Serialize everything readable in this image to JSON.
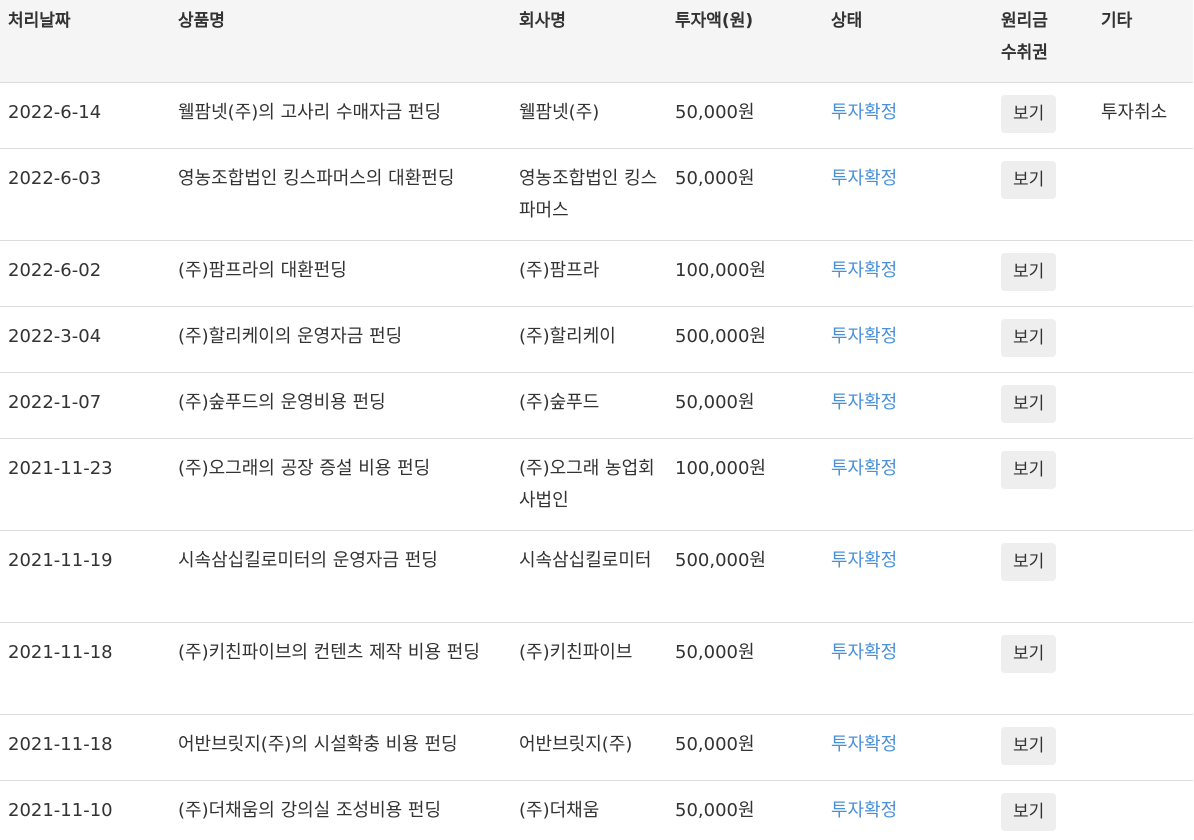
{
  "headers": {
    "date": "처리날짜",
    "product": "상품명",
    "company": "회사명",
    "amount": "투자액(원)",
    "status": "상태",
    "cert_line1": "원리금",
    "cert_line2": "수취권",
    "etc": "기타"
  },
  "rows": [
    {
      "date": "2022-6-14",
      "product": "웰팜넷(주)의 고사리 수매자금 펀딩",
      "company": "웰팜넷(주)",
      "amount": "50,000원",
      "status": "투자확정",
      "view": "보기",
      "etc": "투자취소"
    },
    {
      "date": "2022-6-03",
      "product": "영농조합법인 킹스파머스의 대환펀딩",
      "company": "영농조합법인 킹스파머스",
      "amount": "50,000원",
      "status": "투자확정",
      "view": "보기",
      "etc": ""
    },
    {
      "date": "2022-6-02",
      "product": "(주)팜프라의 대환펀딩",
      "company": "(주)팜프라",
      "amount": "100,000원",
      "status": "투자확정",
      "view": "보기",
      "etc": ""
    },
    {
      "date": "2022-3-04",
      "product": "(주)할리케이의 운영자금 펀딩",
      "company": "(주)할리케이",
      "amount": "500,000원",
      "status": "투자확정",
      "view": "보기",
      "etc": ""
    },
    {
      "date": "2022-1-07",
      "product": "(주)숲푸드의 운영비용 펀딩",
      "company": "(주)숲푸드",
      "amount": "50,000원",
      "status": "투자확정",
      "view": "보기",
      "etc": ""
    },
    {
      "date": "2021-11-23",
      "product": "(주)오그래의 공장 증설 비용 펀딩",
      "company": "(주)오그래 농업회사법인",
      "amount": "100,000원",
      "status": "투자확정",
      "view": "보기",
      "etc": ""
    },
    {
      "date": "2021-11-19",
      "product": "시속삼십킬로미터의 운영자금 펀딩",
      "company": "시속삼십킬로미터",
      "amount": "500,000원",
      "status": "투자확정",
      "view": "보기",
      "etc": ""
    },
    {
      "date": "2021-11-18",
      "product": "(주)키친파이브의 컨텐츠 제작 비용 펀딩",
      "company": "(주)키친파이브",
      "amount": "50,000원",
      "status": "투자확정",
      "view": "보기",
      "etc": ""
    },
    {
      "date": "2021-11-18",
      "product": "어반브릿지(주)의 시설확충 비용 펀딩",
      "company": "어반브릿지(주)",
      "amount": "50,000원",
      "status": "투자확정",
      "view": "보기",
      "etc": ""
    },
    {
      "date": "2021-11-10",
      "product": "(주)더채움의 강의실 조성비용 펀딩",
      "company": "(주)더채움",
      "amount": "50,000원",
      "status": "투자확정",
      "view": "보기",
      "etc": ""
    }
  ],
  "colors": {
    "header_bg": "#f5f5f5",
    "status_text": "#4a90d9",
    "button_bg": "#eeeeee",
    "border": "#dddddd"
  }
}
